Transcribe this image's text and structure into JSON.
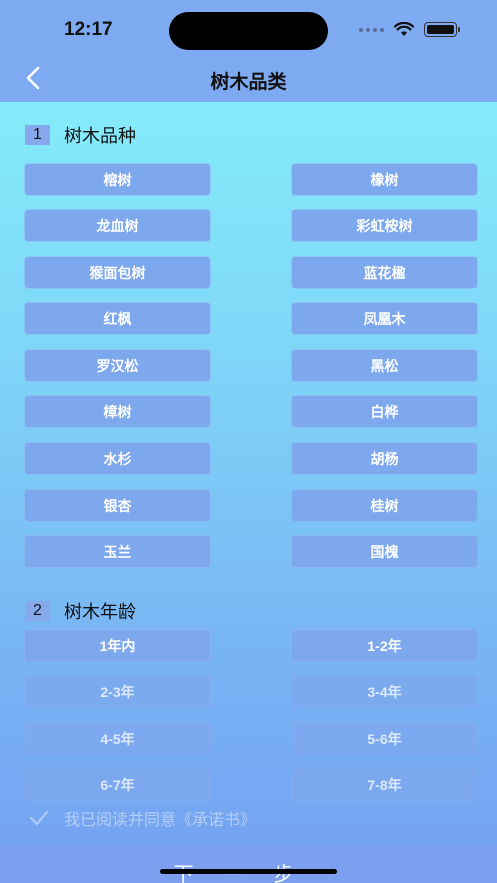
{
  "status": {
    "time": "12:17"
  },
  "nav": {
    "title": "树木品类"
  },
  "section1": {
    "num": "1",
    "title": "树木品种"
  },
  "species": [
    "榕树",
    "橡树",
    "龙血树",
    "彩虹桉树",
    "猴面包树",
    "蓝花楹",
    "红枫",
    "凤凰木",
    "罗汉松",
    "黑松",
    "樟树",
    "白桦",
    "水杉",
    "胡杨",
    "银杏",
    "桂树",
    "玉兰",
    "国槐"
  ],
  "section2": {
    "num": "2",
    "title": "树木年龄"
  },
  "ages": [
    "1年内",
    "1-2年",
    "2-3年",
    "3-4年",
    "4-5年",
    "5-6年",
    "6-7年",
    "7-8年"
  ],
  "agreement": {
    "text": "我已阅读并同意《承诺书》",
    "checked": false
  },
  "footer": {
    "next_label": "下一步"
  }
}
